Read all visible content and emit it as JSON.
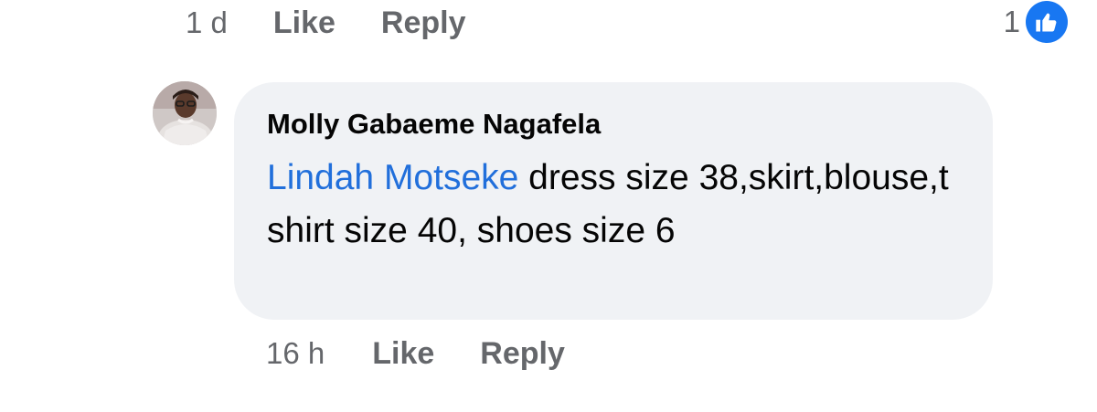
{
  "previous_comment": {
    "time": "1 d",
    "like_label": "Like",
    "reply_label": "Reply",
    "reaction_count": "1",
    "reaction_icon": "thumbs-up-icon",
    "reaction_color": "#1877f2"
  },
  "comment": {
    "author": "Molly Gabaeme Nagafela",
    "mention": "Lindah Motseke",
    "text": " dress size 38,skirt,blouse,t shirt size 40, shoes size 6",
    "time": "16 h",
    "like_label": "Like",
    "reply_label": "Reply",
    "avatar_icon": "profile-photo",
    "mention_color": "#216fdb",
    "bubble_color": "#f0f2f5"
  }
}
